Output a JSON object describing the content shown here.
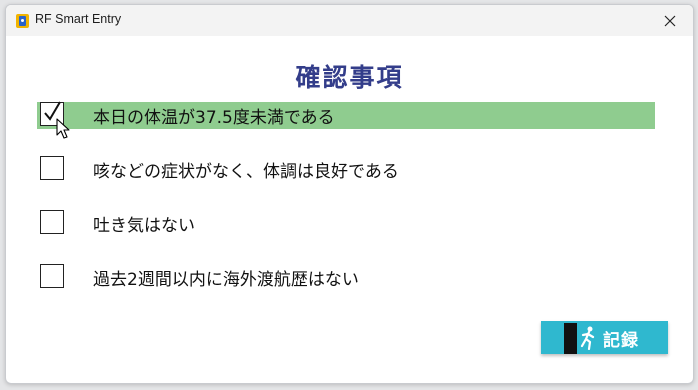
{
  "window": {
    "title": "RF Smart Entry",
    "app_icon": "rf-smart-entry-app-icon",
    "close_icon": "close-icon"
  },
  "main": {
    "heading": "確認事項"
  },
  "checklist": {
    "items": [
      {
        "label": "本日の体温が37.5度未満である",
        "checked": true,
        "highlighted": true
      },
      {
        "label": "咳などの症状がなく、体調は良好である",
        "checked": false,
        "highlighted": false
      },
      {
        "label": "吐き気はない",
        "checked": false,
        "highlighted": false
      },
      {
        "label": "過去2週間以内に海外渡航歴はない",
        "checked": false,
        "highlighted": false
      }
    ]
  },
  "actions": {
    "record_label": "記録",
    "record_icon": "exit-runner-icon"
  },
  "colors": {
    "heading": "#333d8a",
    "highlight": "#8fcc8f",
    "record_button": "#2fb8cf",
    "titlebar": "#f3f3f3"
  }
}
